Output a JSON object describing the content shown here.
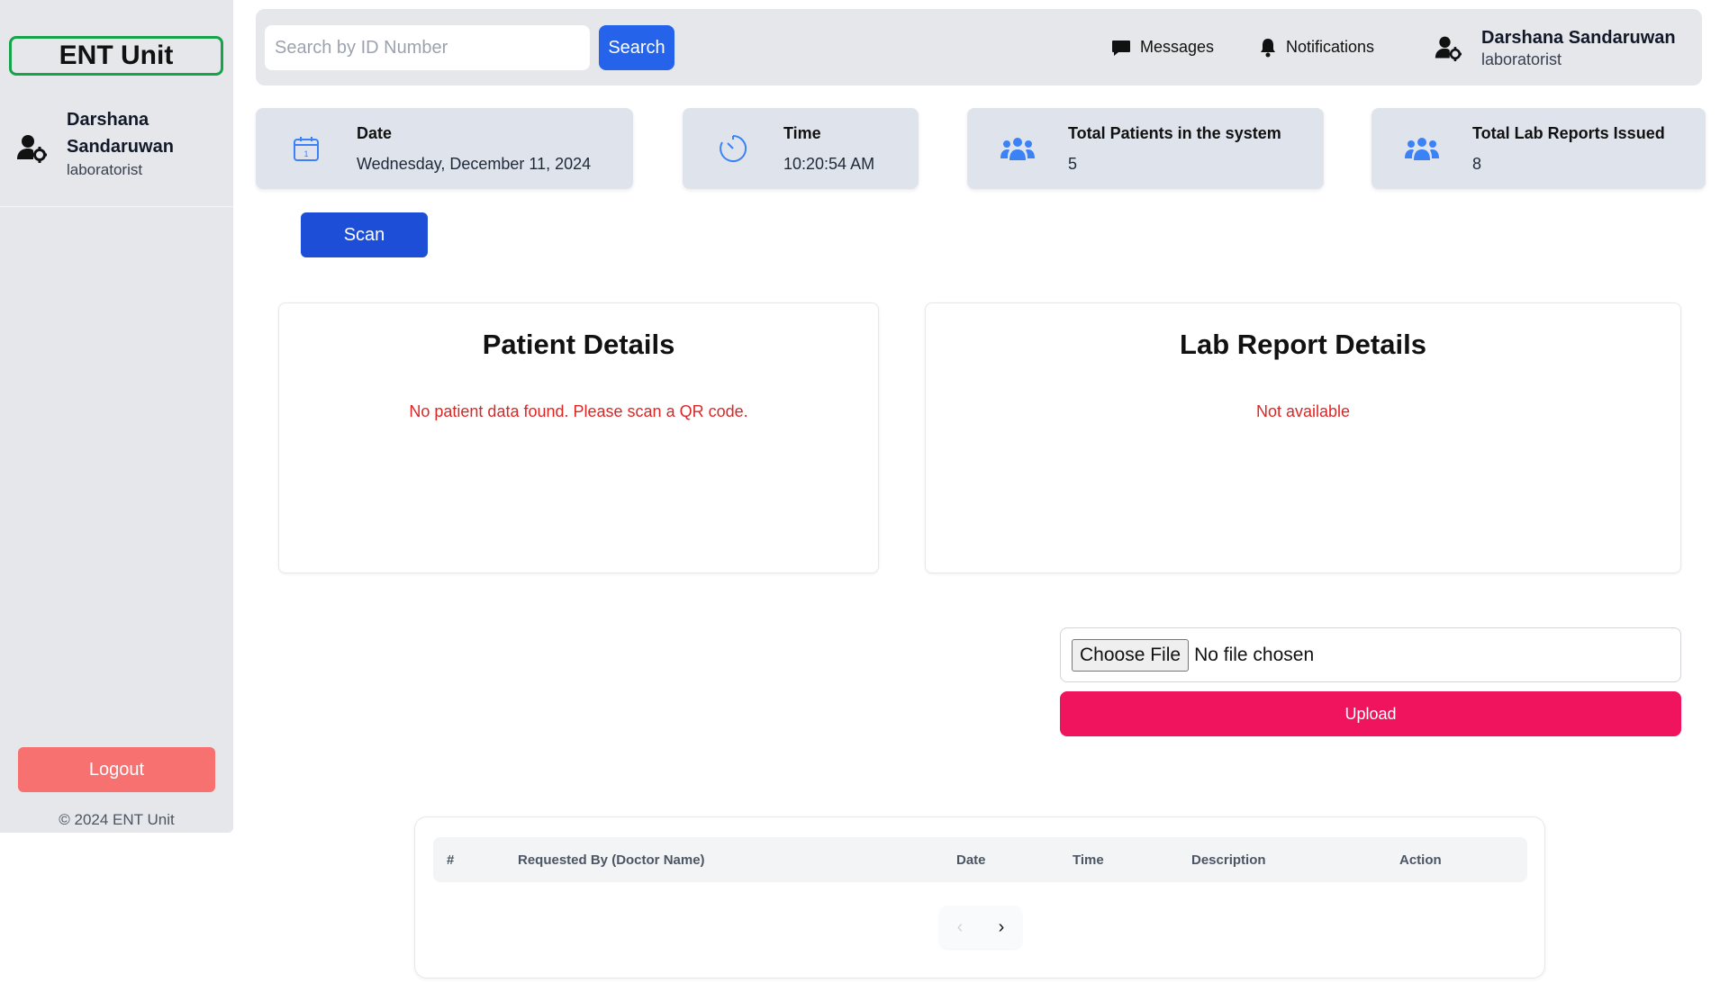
{
  "sidebar": {
    "brand": "ENT Unit",
    "user_name": "Darshana Sandaruwan",
    "user_role": "laboratorist",
    "logout_label": "Logout",
    "copyright": "© 2024 ENT Unit"
  },
  "topbar": {
    "search_placeholder": "Search by ID Number",
    "search_label": "Search",
    "messages_label": "Messages",
    "notifications_label": "Notifications",
    "user_name": "Darshana Sandaruwan",
    "user_role": "laboratorist"
  },
  "stats": {
    "date_label": "Date",
    "date_value": "Wednesday, December 11, 2024",
    "time_label": "Time",
    "time_value": "10:20:54 AM",
    "patients_label": "Total Patients in the system",
    "patients_value": "5",
    "reports_label": "Total Lab Reports Issued",
    "reports_value": "8"
  },
  "scan_label": "Scan",
  "patient_panel": {
    "title": "Patient Details",
    "message": "No patient data found. Please scan a QR code."
  },
  "lab_panel": {
    "title": "Lab Report Details",
    "message": "Not available"
  },
  "upload": {
    "choose_label": "Choose File",
    "file_status": "No file chosen",
    "upload_label": "Upload"
  },
  "table": {
    "columns": [
      "#",
      "Requested By (Doctor Name)",
      "Date",
      "Time",
      "Description",
      "Action"
    ],
    "rows": []
  },
  "pagination": {
    "prev": "‹",
    "next": "›"
  },
  "colors": {
    "primary_blue": "#2563eb",
    "scan_blue": "#1d4ed8",
    "upload_pink": "#f0145f",
    "logout_red": "#f87171",
    "brand_green": "#16a34a",
    "error_red": "#dc2626",
    "icon_blue": "#3b82f6"
  }
}
